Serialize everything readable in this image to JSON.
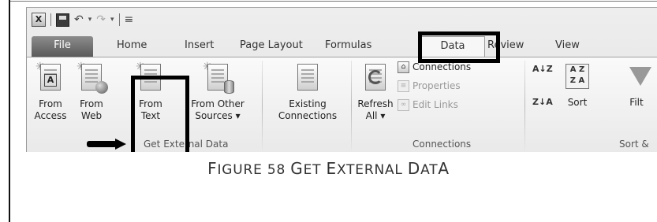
{
  "qat": {
    "excel_icon": "X",
    "save_icon": "save-icon",
    "undo_glyph": "↶",
    "undo_drop": "▾",
    "redo_glyph": "↷",
    "redo_drop": "▾",
    "customize_glyph": "≡"
  },
  "tabs": [
    {
      "label": "File"
    },
    {
      "label": "Home"
    },
    {
      "label": "Insert"
    },
    {
      "label": "Page Layout"
    },
    {
      "label": "Formulas"
    },
    {
      "label": "Data"
    },
    {
      "label": "Review"
    },
    {
      "label": "View"
    }
  ],
  "groups": {
    "get_external": {
      "label": "Get External Data",
      "buttons": [
        {
          "line1": "From",
          "line2": "Access",
          "icon": "access-icon"
        },
        {
          "line1": "From",
          "line2": "Web",
          "icon": "web-icon"
        },
        {
          "line1": "From",
          "line2": "Text",
          "icon": "text-file-icon"
        },
        {
          "line1": "From Other",
          "line2": "Sources ▾",
          "icon": "other-sources-icon"
        },
        {
          "line1": "Existing",
          "line2": "Connections",
          "icon": "existing-connections-icon"
        }
      ]
    },
    "connections": {
      "label": "Connections",
      "refresh": {
        "line1": "Refresh",
        "line2": "All ▾"
      },
      "connections": "Connections",
      "properties": "Properties",
      "edit_links": "Edit Links"
    },
    "sort_filter": {
      "label": "Sort &",
      "sort": "Sort",
      "filter": "Filt",
      "az_glyph": "A↓Z",
      "za_glyph": "Z↓A"
    }
  },
  "annotations": {
    "highlight_color": "#000000"
  },
  "caption": {
    "text_f": "F",
    "text_rest": "IGURE 58 G",
    "text_rest2": "ET E",
    "text_rest3": "XTERNAL D",
    "text_rest4": "ATA"
  }
}
